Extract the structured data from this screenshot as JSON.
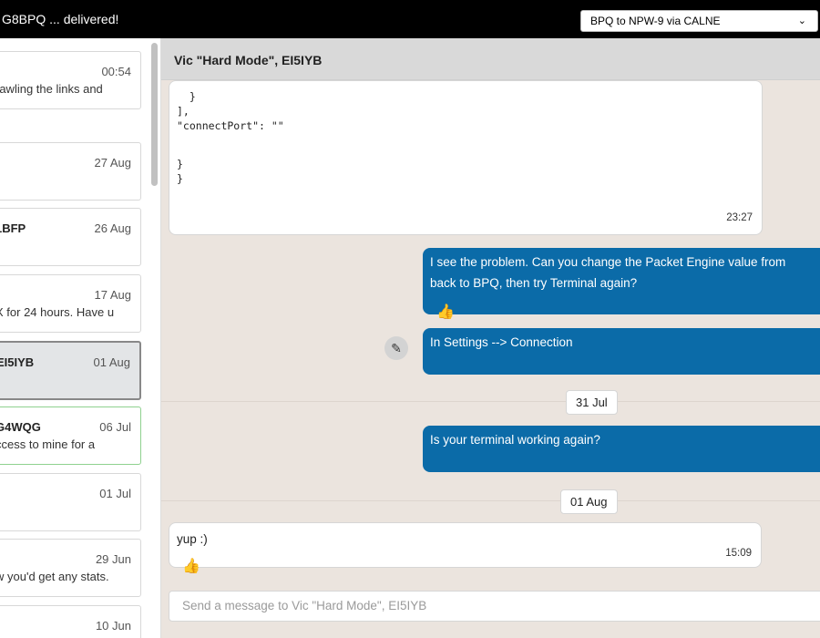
{
  "topbar": {
    "status_text": "G8BPQ ... delivered!",
    "route_select": {
      "selected": "BPQ to NPW-9 via CALNE"
    },
    "chevron_glyph": "⌄"
  },
  "conversations": [
    {
      "name": "",
      "date": "00:54",
      "snippet": "rawling the links and",
      "state": "normal"
    },
    {
      "name": "",
      "date": "27 Aug",
      "snippet": "",
      "state": "normal"
    },
    {
      "name": "1BFP",
      "date": "26 Aug",
      "snippet": "",
      "state": "normal"
    },
    {
      "name": "",
      "date": "17 Aug",
      "snippet": "X for 24 hours. Have u",
      "state": "normal"
    },
    {
      "name": "EI5IYB",
      "date": "01 Aug",
      "snippet": "",
      "state": "selected"
    },
    {
      "name": "G4WQG",
      "date": "06 Jul",
      "snippet": "ccess to mine for a",
      "state": "unread"
    },
    {
      "name": "",
      "date": "01 Jul",
      "snippet": "",
      "state": "normal"
    },
    {
      "name": "",
      "date": "29 Jun",
      "snippet": "w you'd get any stats.",
      "state": "normal"
    },
    {
      "name": "",
      "date": "10 Jun",
      "snippet": "",
      "state": "normal"
    }
  ],
  "chat": {
    "title": "Vic \"Hard Mode\", EI5IYB",
    "code_message": {
      "lines": [
        "  }",
        "],",
        "\"connectPort\": \"\"",
        "",
        "}",
        "}"
      ],
      "time": "23:27"
    },
    "outgoing": [
      {
        "lines": [
          "I see the problem. Can you change the Packet Engine value from",
          "back to BPQ, then try Terminal again?"
        ],
        "reaction": "👍"
      },
      {
        "lines": [
          "In Settings --> Connection"
        ]
      },
      {
        "lines": [
          "Is your terminal working again?"
        ]
      }
    ],
    "date_separators": [
      "31 Jul",
      "01 Aug"
    ],
    "incoming_reply": {
      "text": "yup :)",
      "time": "15:09",
      "reaction": "👍"
    },
    "edit_glyph": "✎",
    "composer_placeholder": "Send a message to Vic \"Hard Mode\", EI5IYB"
  },
  "colors": {
    "topbar_bg": "#000000",
    "outgoing_bubble": "#0b6ba8",
    "chat_bg": "#ebe4de",
    "unread_border": "#8fd18f"
  }
}
